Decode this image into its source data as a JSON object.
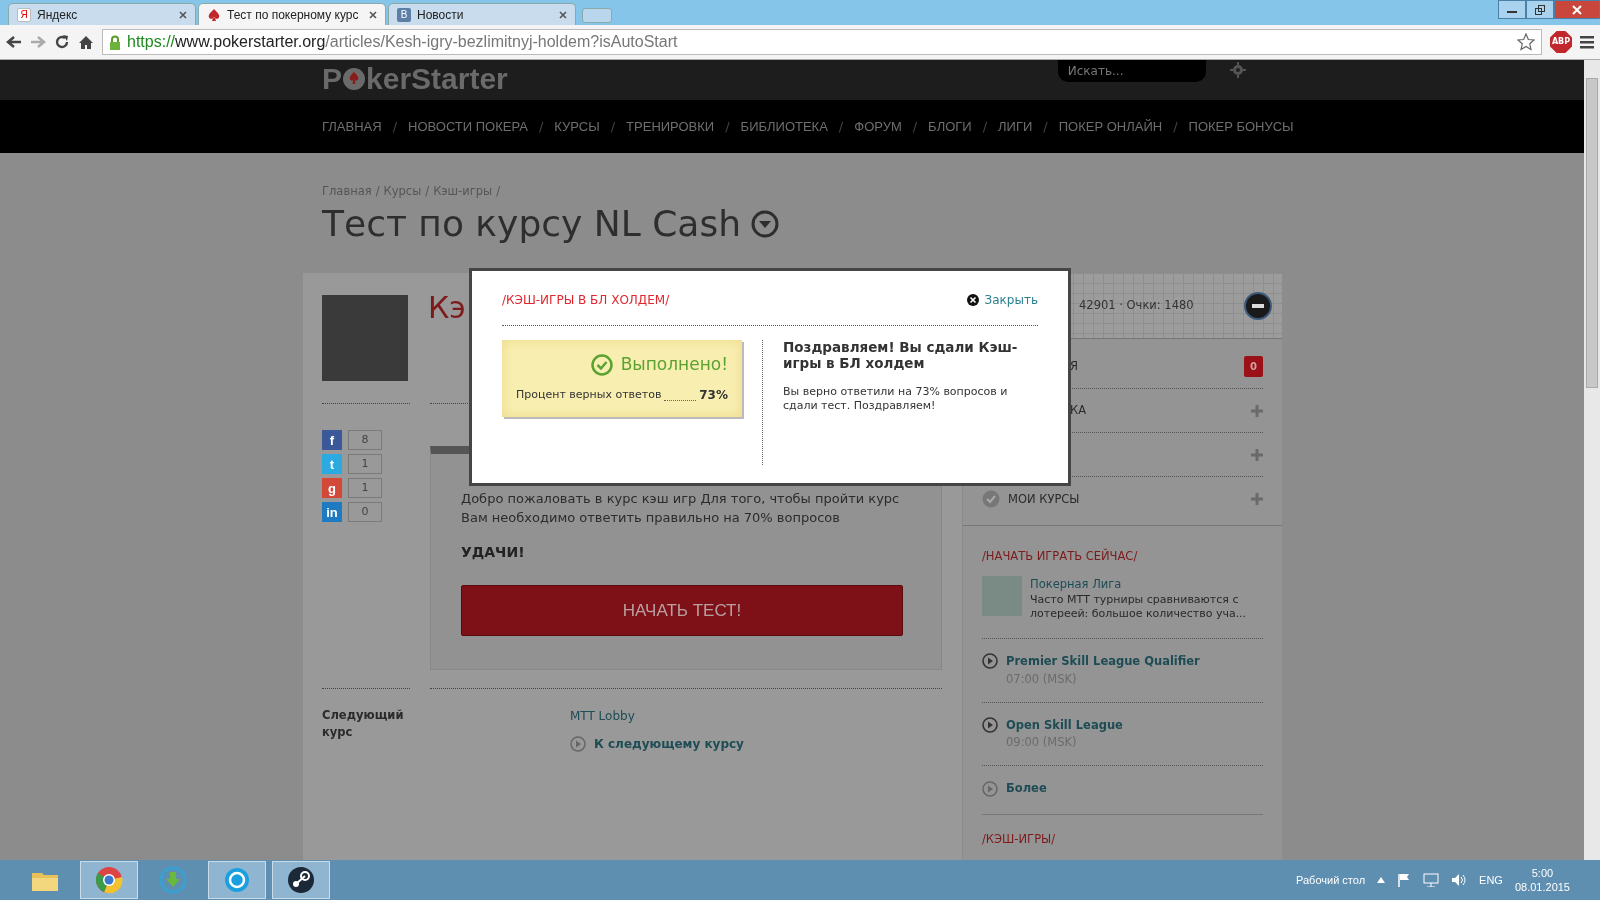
{
  "browser": {
    "tabs": [
      {
        "favicon": "Я",
        "label": "Яндекс",
        "selected": false,
        "kind": "letter"
      },
      {
        "label": "Тест по покерному курс",
        "selected": true,
        "kind": "spade"
      },
      {
        "favicon": "В",
        "label": "Новости",
        "selected": false,
        "kind": "letter"
      }
    ],
    "url": {
      "scheme": "https://",
      "host": "www.pokerstarter.org",
      "path": "/articles/Kesh-igry-bezlimitnyj-holdem?isAutoStart"
    },
    "extension": "ABP"
  },
  "site": {
    "logo": {
      "before": "P",
      "after": "kerStarter"
    },
    "search": {
      "placeholder": "Искать..."
    },
    "nav_separator": "/",
    "nav": [
      "ГЛАВНАЯ",
      "НОВОСТИ ПОКЕРА",
      "КУРСЫ",
      "ТРЕНИРОВКИ",
      "БИБЛИОТЕКА",
      "ФОРУМ",
      "БЛОГИ",
      "ЛИГИ",
      "ПОКЕР ОНЛАЙН",
      "ПОКЕР БОНУСЫ"
    ]
  },
  "breadcrumb_separator": "/",
  "breadcrumb": [
    "Главная",
    "Курсы",
    "Кэш-игры"
  ],
  "title": "Тест по курсу NL Cash",
  "course": {
    "title": "Кэ",
    "social": [
      {
        "letter": "f",
        "count": "8",
        "color": "#3b5998"
      },
      {
        "letter": "t",
        "count": "1",
        "color": "#2ba9e1"
      },
      {
        "letter": "g",
        "count": "1",
        "color": "#d34836"
      },
      {
        "letter": "in",
        "count": "0",
        "color": "#1f7bc1"
      }
    ],
    "intro": "Добро пожаловать в курс кэш игр Для того, чтобы пройти курс Вам необходимо ответить правильно на 70% вопросов",
    "wish": "УДАЧИ!",
    "start_button": "НАЧАТЬ ТЕСТ!",
    "next_label": "Следующий курс",
    "next_title": "MTT Lobby",
    "next_link": "К следующему курсу"
  },
  "sidebar": {
    "stats": "42901 · Очки:  1480",
    "items": [
      {
        "label": "Я",
        "kind": "badge",
        "badge": "0"
      },
      {
        "label": "КА",
        "kind": "plus"
      },
      {
        "kind": "plus"
      },
      {
        "label": "МОИ КУРСЫ",
        "kind": "plus",
        "checked": true
      }
    ],
    "play_heading": "/НАЧАТЬ ИГРАТЬ СЕЙЧАС/",
    "promo": {
      "title": "Покерная Лига",
      "text": "Часто МТТ турниры сравниваются с лотереей: большое количество уча..."
    },
    "events": [
      {
        "name": "Premier Skill League Qualifier",
        "time": "07:00 (MSK)"
      },
      {
        "name": "Open Skill League",
        "time": "09:00 (MSK)"
      }
    ],
    "more": "Более",
    "next_heading": "/КЭШ-ИГРЫ/"
  },
  "modal": {
    "heading": "/КЭШ-ИГРЫ В БЛ ХОЛДЕМ/",
    "close": "Закрыть",
    "result": {
      "status": "Выполнено!",
      "label": "Процент верных ответов",
      "value": "73%",
      "passed": true
    },
    "message_title": "Поздравляем! Вы сдали Кэш-игры в БЛ холдем",
    "message": "Вы верно ответили на 73% вопросов и сдали тест. Поздравляем!"
  },
  "taskbar": {
    "desktop": "Рабочий стол",
    "language": "ENG",
    "time": "5:00",
    "date": "08.01.2015"
  }
}
